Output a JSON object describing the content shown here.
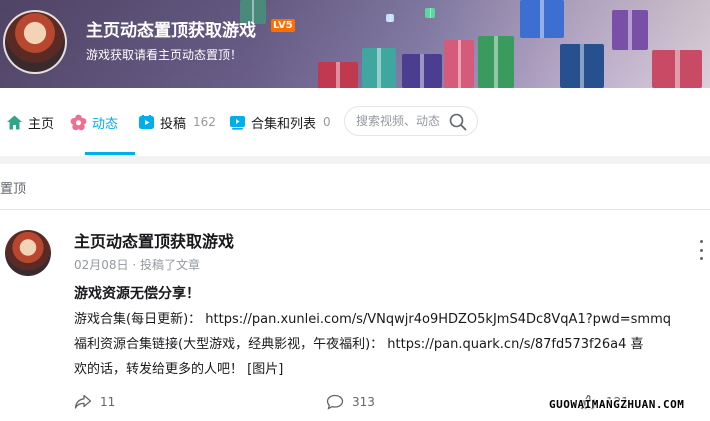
{
  "header": {
    "title": "主页动态置顶获取游戏",
    "level": "LV5",
    "subtitle": "游戏获取请看主页动态置顶！"
  },
  "nav": {
    "home": "主页",
    "dynamic": "动态",
    "uploads": "投稿",
    "uploads_count": "162",
    "collections": "合集和列表",
    "collections_count": "0",
    "search_placeholder": "搜索视频、动态"
  },
  "pinned": {
    "label": "置顶"
  },
  "post": {
    "author": "主页动态置顶获取游戏",
    "meta": "02月08日 · 投稿了文章",
    "title": "游戏资源无偿分享！",
    "line1": "游戏合集(每日更新)： https://pan.xunlei.com/s/VNqwjr4o9HDZO5kJmS4Dc8VqA1?pwd=smmq",
    "line2": "福利资源合集链接(大型游戏，经典影视，午夜福利)： https://pan.quark.cn/s/87fd573f26a4 喜",
    "line3": "欢的话，转发给更多的人吧！ [图片]",
    "shares": "11",
    "comments": "313",
    "likes": "121"
  },
  "watermark": "GUOWAIMANGZHUAN.COM",
  "colors": {
    "accent": "#00aeec",
    "level": "#ff6c00"
  }
}
